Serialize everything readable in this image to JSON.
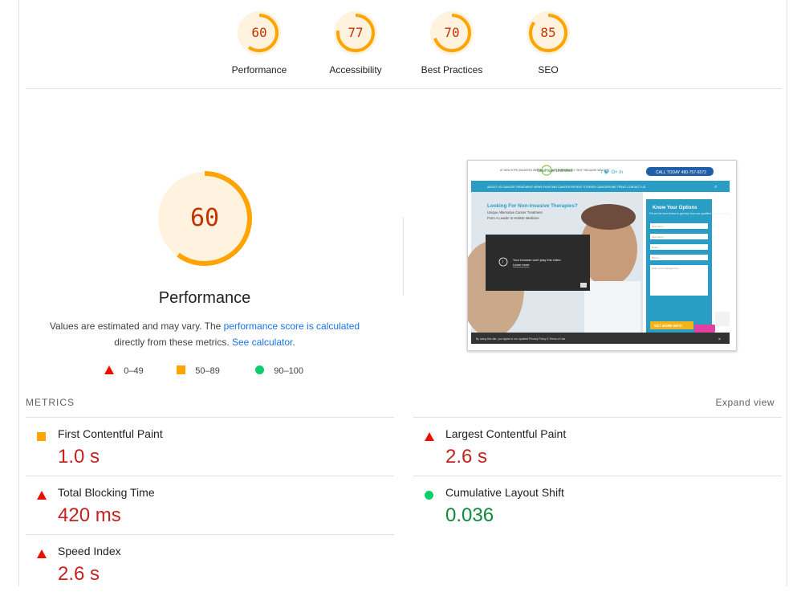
{
  "categories": [
    {
      "score": "60",
      "label": "Performance",
      "fraction": 0.6
    },
    {
      "score": "77",
      "label": "Accessibility",
      "fraction": 0.77
    },
    {
      "score": "70",
      "label": "Best Practices",
      "fraction": 0.7
    },
    {
      "score": "85",
      "label": "SEO",
      "fraction": 0.85
    }
  ],
  "performance": {
    "score": "60",
    "fraction": 0.6,
    "title": "Performance",
    "desc_prefix": "Values are estimated and may vary. The ",
    "desc_link": "performance score is calculated",
    "desc_mid": "directly from these metrics. ",
    "calc_link": "See calculator",
    "desc_end": "."
  },
  "legend": {
    "fail": "0–49",
    "average": "50–89",
    "pass": "90–100"
  },
  "metrics": {
    "title": "METRICS",
    "expand": "Expand view",
    "items": [
      {
        "name": "First Contentful Paint",
        "value": "1.0 s",
        "rating": "average"
      },
      {
        "name": "Largest Contentful Paint",
        "value": "2.6 s",
        "rating": "fail"
      },
      {
        "name": "Total Blocking Time",
        "value": "420 ms",
        "rating": "fail"
      },
      {
        "name": "Cumulative Layout Shift",
        "value": "0.036",
        "rating": "pass"
      },
      {
        "name": "Speed Index",
        "value": "2.6 s",
        "rating": "fail"
      }
    ]
  },
  "screenshot": {
    "header_text": "AT NEW HOPE UNLIMITED WE TREAT CANCER DIFFERENTLY. WHY? BECAUSE WE CARE.",
    "brand": "NewHope Unlimited",
    "call": "CALL TODAY 480-757-6573",
    "nav": [
      "ABOUT US",
      "CANCER TREATMENT",
      "NEWS",
      "FIGHTING CANCER",
      "PATIENT STORIES",
      "CANCERS WE TREAT",
      "CONTACT US"
    ],
    "headline": "Looking For Non-invasive Therapies?",
    "sub1": "Unique Alternative Cancer Treatment",
    "sub2": "From A Leader In Holistic Medicine",
    "video_msg": "Your browser can't play this video.",
    "video_link": "Learn more",
    "form_title": "Know Your Options",
    "form_sub": "Fill out the form below to get help from our qualified staff of doctors.",
    "fields": [
      "First Name",
      "Last Name",
      "Email",
      "Phone",
      "Write your message here"
    ],
    "form_btn": "GET MORE INFO!",
    "cookie": "By using this site, you agree to our updated Privacy Policy & Terms of Use."
  },
  "colors": {
    "average": "#ffa400",
    "fail": "#eb0f00",
    "pass": "#0cce6b",
    "teal": "#2a9dc4"
  }
}
